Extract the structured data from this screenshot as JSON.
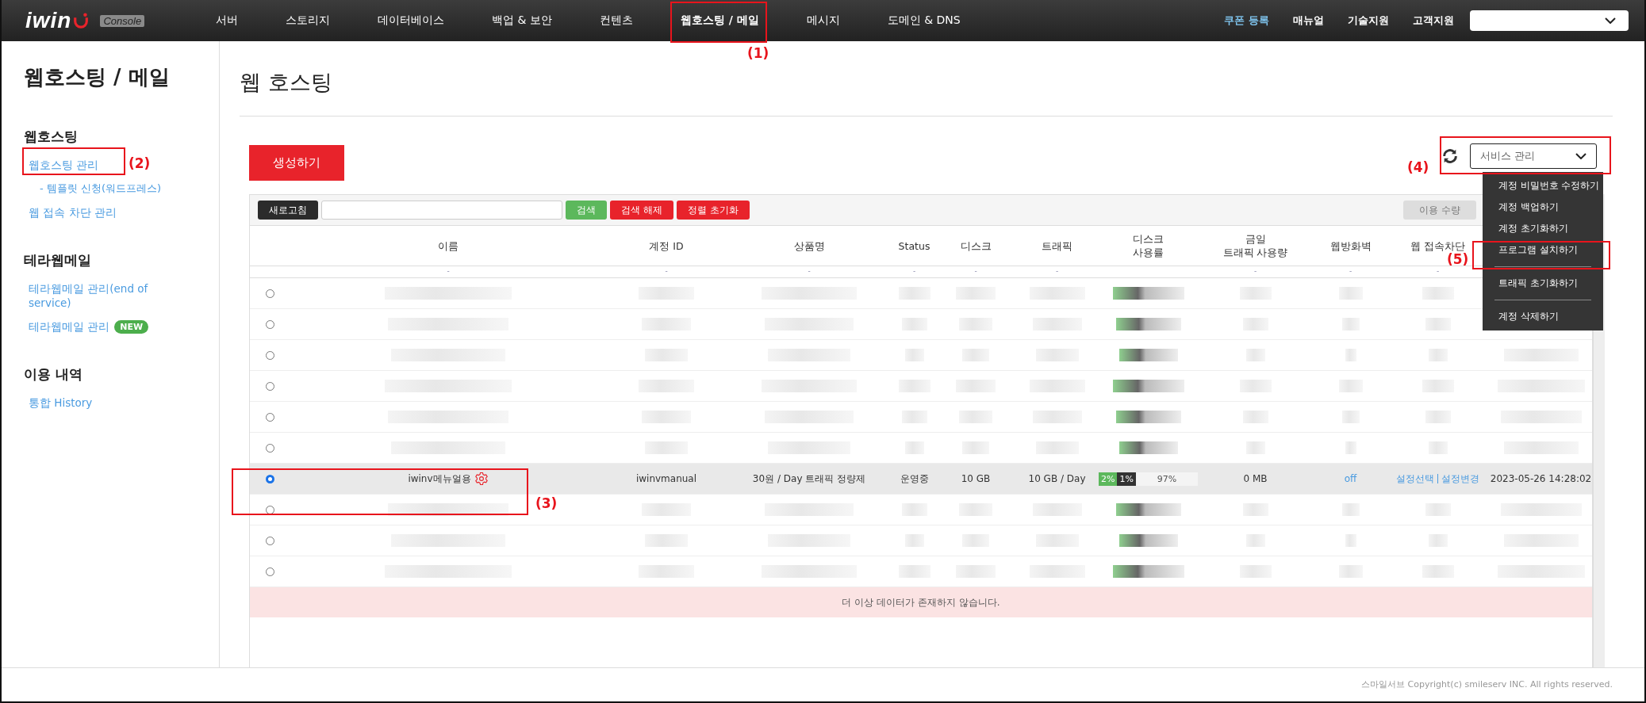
{
  "topbar": {
    "logo": {
      "text": "iwin",
      "badge": "Console"
    },
    "nav": [
      {
        "label": "서버",
        "selected": false
      },
      {
        "label": "스토리지",
        "selected": false
      },
      {
        "label": "데이터베이스",
        "selected": false
      },
      {
        "label": "백업 & 보안",
        "selected": false
      },
      {
        "label": "컨텐츠",
        "selected": false
      },
      {
        "label": "웹호스팅 / 메일",
        "selected": true
      },
      {
        "label": "메시지",
        "selected": false
      },
      {
        "label": "도메인 & DNS",
        "selected": false
      }
    ],
    "links": [
      {
        "label": "쿠폰 등록",
        "kind": "highlight"
      },
      {
        "label": "매뉴얼",
        "kind": "plain"
      },
      {
        "label": "기술지원",
        "kind": "plain"
      },
      {
        "label": "고객지원",
        "kind": "plain"
      }
    ],
    "account_select": {
      "expanded": false
    }
  },
  "sidebar": {
    "title": "웹호스팅 / 메일",
    "sections": [
      {
        "heading": "웹호스팅",
        "items": [
          {
            "label": "웹호스팅 관리",
            "kind": "item"
          },
          {
            "label": "- 템플릿 신청(워드프레스)",
            "kind": "subitem"
          },
          {
            "label": "웹 접속 차단 관리",
            "kind": "item"
          }
        ]
      },
      {
        "heading": "테라웹메일",
        "items": [
          {
            "label": "테라웹메일 관리(end of service)",
            "kind": "item"
          },
          {
            "label": "테라웹메일 관리",
            "kind": "badged",
            "badge": "NEW"
          }
        ]
      },
      {
        "heading": "이용 내역",
        "items": [
          {
            "label": "통합 History",
            "kind": "item"
          }
        ]
      }
    ]
  },
  "page": {
    "title": "웹 호스팅",
    "create_button": "생성하기",
    "service_select": {
      "value": "서비스 관리",
      "expanded": true,
      "menu": [
        {
          "label": "계정 비밀번호 수정하기",
          "kind": "item"
        },
        {
          "label": "계정 백업하기",
          "kind": "item"
        },
        {
          "label": "계정 초기화하기",
          "kind": "item"
        },
        {
          "label": "프로그램 설치하기",
          "kind": "item"
        },
        {
          "kind": "divider"
        },
        {
          "label": "트래픽 초기화하기",
          "kind": "item"
        },
        {
          "kind": "divider"
        },
        {
          "label": "계정 삭제하기",
          "kind": "item"
        }
      ]
    }
  },
  "toolbar": {
    "refresh_button": "새로고침",
    "search_button": "검색",
    "clear_button": "검색 해제",
    "reset_sort_button": "정렬 초기화",
    "usage_button": "이용 수량"
  },
  "table": {
    "columns": [
      {},
      {
        "label": "이름",
        "filter": "-"
      },
      {
        "label": "계정 ID",
        "filter": "-"
      },
      {
        "label": "상품명",
        "filter": "-"
      },
      {
        "label": "Status",
        "filter": "-"
      },
      {
        "label": "디스크",
        "filter": "-"
      },
      {
        "label": "트래픽",
        "filter": "-"
      },
      {
        "label": "디스크\n사용률"
      },
      {
        "label": "금일\n트래픽 사용량",
        "filter": "-"
      },
      {
        "label": "웹방화벽",
        "filter": "-"
      },
      {
        "label": "웹 접속차단",
        "filter": "-"
      },
      {}
    ],
    "rows": [
      {
        "kind": "redacted",
        "selected": false
      },
      {
        "kind": "redacted",
        "selected": false
      },
      {
        "kind": "redacted",
        "selected": false
      },
      {
        "kind": "redacted",
        "selected": false
      },
      {
        "kind": "redacted",
        "selected": false
      },
      {
        "kind": "redacted",
        "selected": false
      },
      {
        "kind": "data",
        "selected": true,
        "name": "iwinv메뉴얼용",
        "account_id": "iwinvmanual",
        "product": "30원 / Day 트래픽 정량제",
        "status": "운영중",
        "disk": "10 GB",
        "traffic": "10 GB / Day",
        "disk_usage": [
          {
            "label": "2%",
            "kind": "used"
          },
          {
            "label": "1%",
            "kind": "other"
          },
          {
            "label": "97%",
            "kind": "free"
          }
        ],
        "today_traffic": "0 MB",
        "firewall": "off",
        "block_links": [
          "설정선택",
          "설정변경"
        ],
        "date": "2023-05-26 14:28:02"
      },
      {
        "kind": "redacted",
        "selected": false
      },
      {
        "kind": "redacted",
        "selected": false
      },
      {
        "kind": "redacted",
        "selected": false
      }
    ],
    "empty_message": "더 이상 데이터가 존재하지 않습니다."
  },
  "footer": "스마일서브 Copyright(c) smileserv INC. All rights reserved.",
  "annotations": [
    {
      "label": "(1)"
    },
    {
      "label": "(2)"
    },
    {
      "label": "(3)"
    },
    {
      "label": "(4)"
    },
    {
      "label": "(5)"
    }
  ]
}
